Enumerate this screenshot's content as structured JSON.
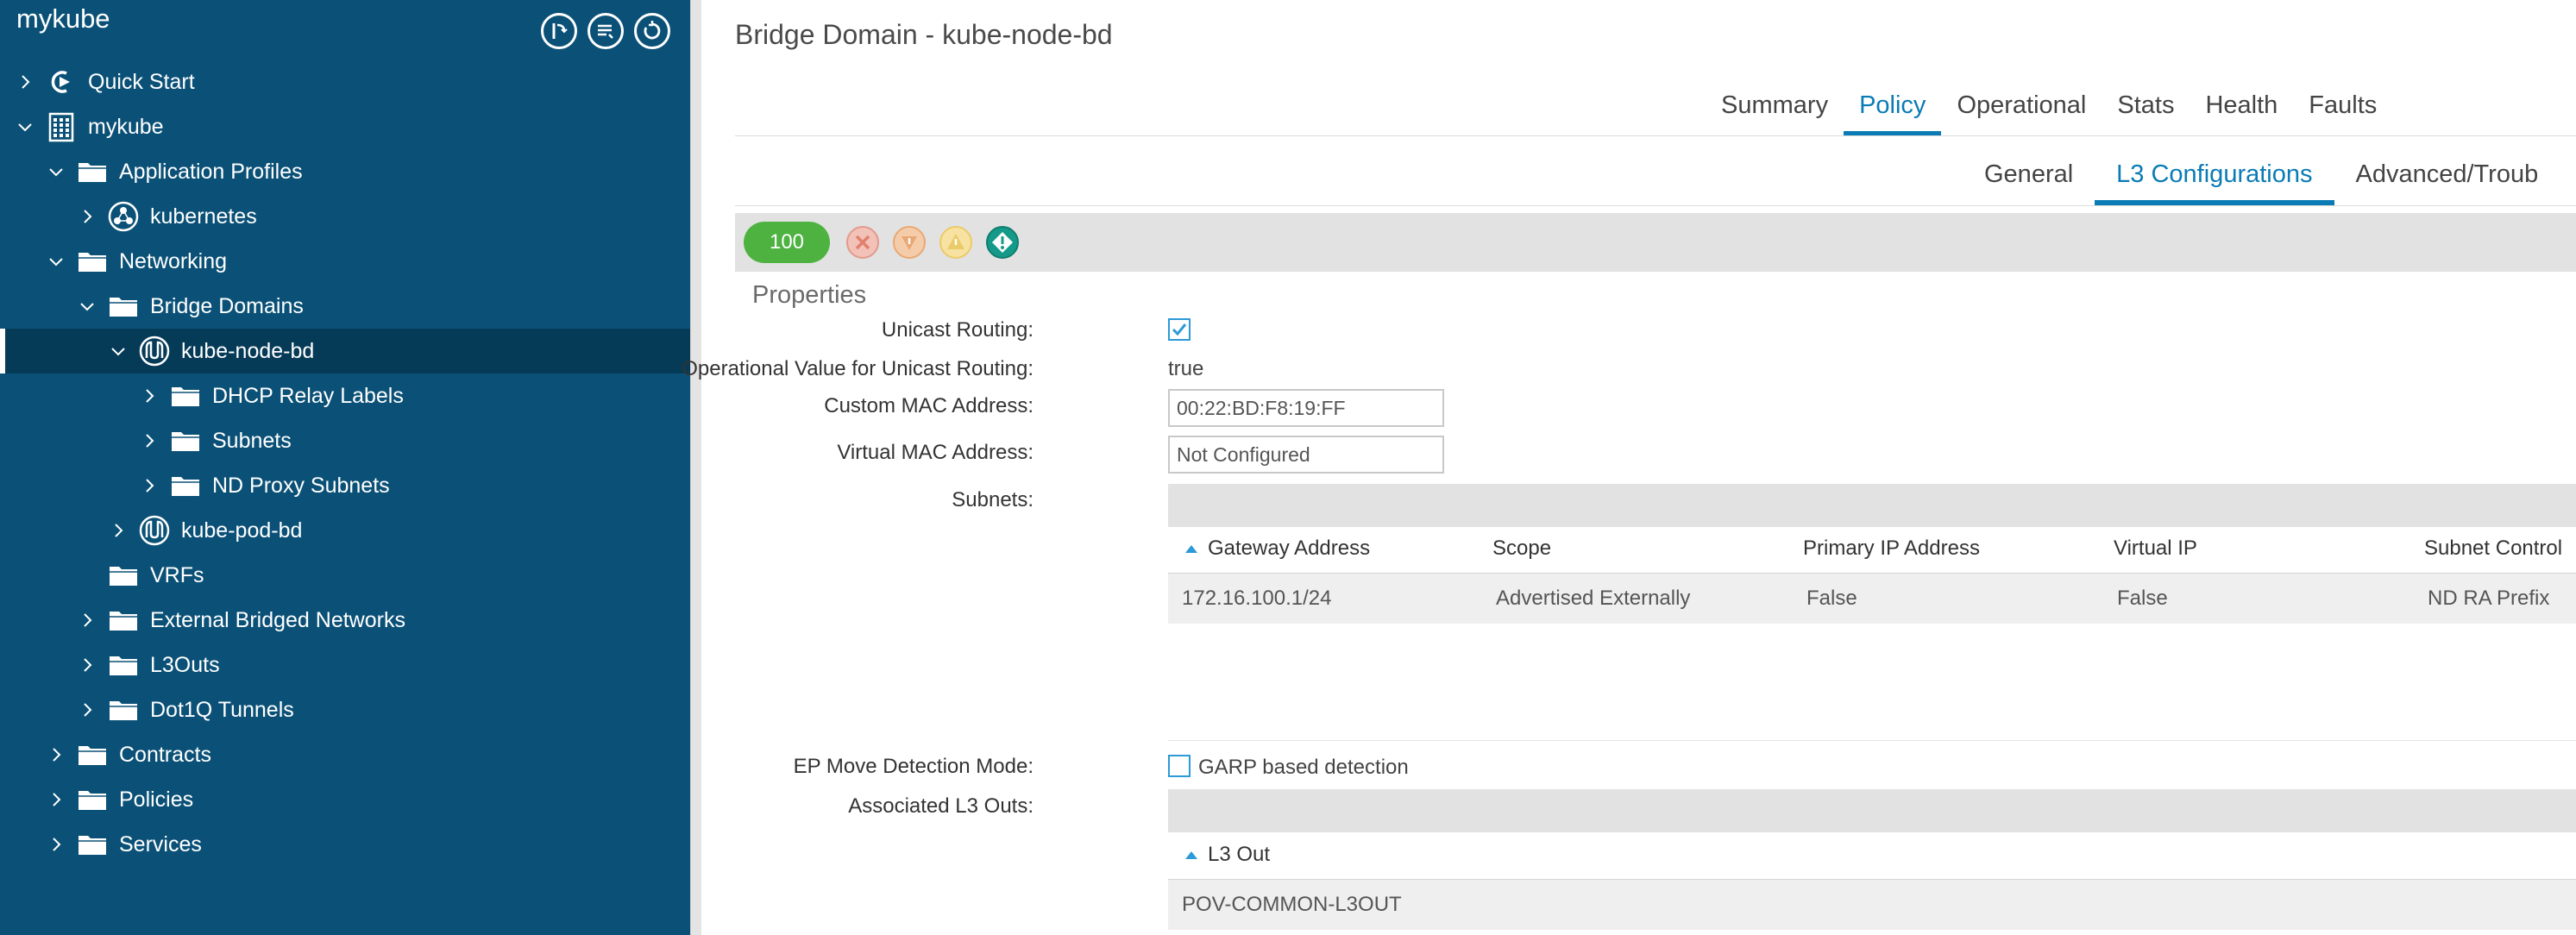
{
  "sidebar": {
    "title": "mykube",
    "buttons": [
      {
        "name": "history-icon",
        "icon": "history-icon"
      },
      {
        "name": "list-filter-icon",
        "icon": "list-filter-icon"
      },
      {
        "name": "refresh-icon",
        "icon": "refresh-icon"
      }
    ],
    "tree": [
      {
        "label": "Quick Start",
        "depth": 0,
        "expanded": false,
        "icon": "quick-start-icon"
      },
      {
        "label": "mykube",
        "depth": 0,
        "expanded": true,
        "icon": "tenant-icon"
      },
      {
        "label": "Application Profiles",
        "depth": 1,
        "expanded": true,
        "icon": "folder-icon"
      },
      {
        "label": "kubernetes",
        "depth": 2,
        "expanded": false,
        "icon": "app-profile-icon"
      },
      {
        "label": "Networking",
        "depth": 1,
        "expanded": true,
        "icon": "folder-icon"
      },
      {
        "label": "Bridge Domains",
        "depth": 2,
        "expanded": true,
        "icon": "folder-icon"
      },
      {
        "label": "kube-node-bd",
        "depth": 3,
        "expanded": true,
        "icon": "bridge-domain-icon",
        "selected": true
      },
      {
        "label": "DHCP Relay Labels",
        "depth": 4,
        "expanded": false,
        "icon": "folder-icon"
      },
      {
        "label": "Subnets",
        "depth": 4,
        "expanded": false,
        "icon": "folder-icon"
      },
      {
        "label": "ND Proxy Subnets",
        "depth": 4,
        "expanded": false,
        "icon": "folder-icon"
      },
      {
        "label": "kube-pod-bd",
        "depth": 3,
        "expanded": false,
        "icon": "bridge-domain-icon"
      },
      {
        "label": "VRFs",
        "depth": 2,
        "expanded": null,
        "icon": "folder-icon"
      },
      {
        "label": "External Bridged Networks",
        "depth": 2,
        "expanded": false,
        "icon": "folder-icon"
      },
      {
        "label": "L3Outs",
        "depth": 2,
        "expanded": false,
        "icon": "folder-icon"
      },
      {
        "label": "Dot1Q Tunnels",
        "depth": 2,
        "expanded": false,
        "icon": "folder-icon"
      },
      {
        "label": "Contracts",
        "depth": 1,
        "expanded": false,
        "icon": "folder-icon"
      },
      {
        "label": "Policies",
        "depth": 1,
        "expanded": false,
        "icon": "folder-icon"
      },
      {
        "label": "Services",
        "depth": 1,
        "expanded": false,
        "icon": "folder-icon"
      }
    ]
  },
  "main": {
    "title": "Bridge Domain - kube-node-bd",
    "tabs": [
      {
        "label": "Summary",
        "active": false
      },
      {
        "label": "Policy",
        "active": true
      },
      {
        "label": "Operational",
        "active": false
      },
      {
        "label": "Stats",
        "active": false
      },
      {
        "label": "Health",
        "active": false
      },
      {
        "label": "Faults",
        "active": false
      }
    ],
    "subtabs": [
      {
        "label": "General",
        "active": false
      },
      {
        "label": "L3 Configurations",
        "active": true
      },
      {
        "label": "Advanced/Troub",
        "active": false
      }
    ],
    "health": {
      "score": "100",
      "score_color": "#4db240",
      "fault_icons": [
        "critical-fault-icon",
        "major-fault-icon",
        "minor-fault-icon",
        "warning-fault-icon"
      ]
    },
    "properties": {
      "heading": "Properties",
      "unicast_routing_label": "Unicast Routing:",
      "unicast_routing_checked": true,
      "op_unicast_label": "Operational Value for Unicast Routing:",
      "op_unicast_value": "true",
      "custom_mac_label": "Custom MAC Address:",
      "custom_mac_value": "00:22:BD:F8:19:FF",
      "virtual_mac_label": "Virtual MAC Address:",
      "virtual_mac_value": "Not Configured",
      "subnets_label": "Subnets:",
      "ep_move_label": "EP Move Detection Mode:",
      "ep_move_option": "GARP based detection",
      "ep_move_checked": false,
      "assoc_l3outs_label": "Associated L3 Outs:"
    },
    "subnets_table": {
      "columns": [
        "Gateway Address",
        "Scope",
        "Primary IP Address",
        "Virtual IP",
        "Subnet Control"
      ],
      "rows": [
        [
          "172.16.100.1/24",
          "Advertised Externally",
          "False",
          "False",
          "ND RA Prefix"
        ]
      ]
    },
    "l3out_table": {
      "columns": [
        "L3 Out"
      ],
      "rows": [
        [
          "POV-COMMON-L3OUT"
        ]
      ]
    }
  }
}
